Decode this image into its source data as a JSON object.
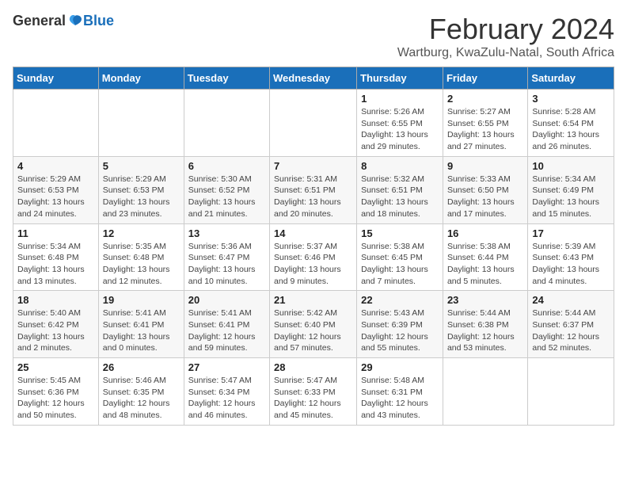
{
  "header": {
    "logo_general": "General",
    "logo_blue": "Blue",
    "month_title": "February 2024",
    "location": "Wartburg, KwaZulu-Natal, South Africa"
  },
  "days_of_week": [
    "Sunday",
    "Monday",
    "Tuesday",
    "Wednesday",
    "Thursday",
    "Friday",
    "Saturday"
  ],
  "weeks": [
    [
      {
        "day": "",
        "info": ""
      },
      {
        "day": "",
        "info": ""
      },
      {
        "day": "",
        "info": ""
      },
      {
        "day": "",
        "info": ""
      },
      {
        "day": "1",
        "info": "Sunrise: 5:26 AM\nSunset: 6:55 PM\nDaylight: 13 hours\nand 29 minutes."
      },
      {
        "day": "2",
        "info": "Sunrise: 5:27 AM\nSunset: 6:55 PM\nDaylight: 13 hours\nand 27 minutes."
      },
      {
        "day": "3",
        "info": "Sunrise: 5:28 AM\nSunset: 6:54 PM\nDaylight: 13 hours\nand 26 minutes."
      }
    ],
    [
      {
        "day": "4",
        "info": "Sunrise: 5:29 AM\nSunset: 6:53 PM\nDaylight: 13 hours\nand 24 minutes."
      },
      {
        "day": "5",
        "info": "Sunrise: 5:29 AM\nSunset: 6:53 PM\nDaylight: 13 hours\nand 23 minutes."
      },
      {
        "day": "6",
        "info": "Sunrise: 5:30 AM\nSunset: 6:52 PM\nDaylight: 13 hours\nand 21 minutes."
      },
      {
        "day": "7",
        "info": "Sunrise: 5:31 AM\nSunset: 6:51 PM\nDaylight: 13 hours\nand 20 minutes."
      },
      {
        "day": "8",
        "info": "Sunrise: 5:32 AM\nSunset: 6:51 PM\nDaylight: 13 hours\nand 18 minutes."
      },
      {
        "day": "9",
        "info": "Sunrise: 5:33 AM\nSunset: 6:50 PM\nDaylight: 13 hours\nand 17 minutes."
      },
      {
        "day": "10",
        "info": "Sunrise: 5:34 AM\nSunset: 6:49 PM\nDaylight: 13 hours\nand 15 minutes."
      }
    ],
    [
      {
        "day": "11",
        "info": "Sunrise: 5:34 AM\nSunset: 6:48 PM\nDaylight: 13 hours\nand 13 minutes."
      },
      {
        "day": "12",
        "info": "Sunrise: 5:35 AM\nSunset: 6:48 PM\nDaylight: 13 hours\nand 12 minutes."
      },
      {
        "day": "13",
        "info": "Sunrise: 5:36 AM\nSunset: 6:47 PM\nDaylight: 13 hours\nand 10 minutes."
      },
      {
        "day": "14",
        "info": "Sunrise: 5:37 AM\nSunset: 6:46 PM\nDaylight: 13 hours\nand 9 minutes."
      },
      {
        "day": "15",
        "info": "Sunrise: 5:38 AM\nSunset: 6:45 PM\nDaylight: 13 hours\nand 7 minutes."
      },
      {
        "day": "16",
        "info": "Sunrise: 5:38 AM\nSunset: 6:44 PM\nDaylight: 13 hours\nand 5 minutes."
      },
      {
        "day": "17",
        "info": "Sunrise: 5:39 AM\nSunset: 6:43 PM\nDaylight: 13 hours\nand 4 minutes."
      }
    ],
    [
      {
        "day": "18",
        "info": "Sunrise: 5:40 AM\nSunset: 6:42 PM\nDaylight: 13 hours\nand 2 minutes."
      },
      {
        "day": "19",
        "info": "Sunrise: 5:41 AM\nSunset: 6:41 PM\nDaylight: 13 hours\nand 0 minutes."
      },
      {
        "day": "20",
        "info": "Sunrise: 5:41 AM\nSunset: 6:41 PM\nDaylight: 12 hours\nand 59 minutes."
      },
      {
        "day": "21",
        "info": "Sunrise: 5:42 AM\nSunset: 6:40 PM\nDaylight: 12 hours\nand 57 minutes."
      },
      {
        "day": "22",
        "info": "Sunrise: 5:43 AM\nSunset: 6:39 PM\nDaylight: 12 hours\nand 55 minutes."
      },
      {
        "day": "23",
        "info": "Sunrise: 5:44 AM\nSunset: 6:38 PM\nDaylight: 12 hours\nand 53 minutes."
      },
      {
        "day": "24",
        "info": "Sunrise: 5:44 AM\nSunset: 6:37 PM\nDaylight: 12 hours\nand 52 minutes."
      }
    ],
    [
      {
        "day": "25",
        "info": "Sunrise: 5:45 AM\nSunset: 6:36 PM\nDaylight: 12 hours\nand 50 minutes."
      },
      {
        "day": "26",
        "info": "Sunrise: 5:46 AM\nSunset: 6:35 PM\nDaylight: 12 hours\nand 48 minutes."
      },
      {
        "day": "27",
        "info": "Sunrise: 5:47 AM\nSunset: 6:34 PM\nDaylight: 12 hours\nand 46 minutes."
      },
      {
        "day": "28",
        "info": "Sunrise: 5:47 AM\nSunset: 6:33 PM\nDaylight: 12 hours\nand 45 minutes."
      },
      {
        "day": "29",
        "info": "Sunrise: 5:48 AM\nSunset: 6:31 PM\nDaylight: 12 hours\nand 43 minutes."
      },
      {
        "day": "",
        "info": ""
      },
      {
        "day": "",
        "info": ""
      }
    ]
  ]
}
